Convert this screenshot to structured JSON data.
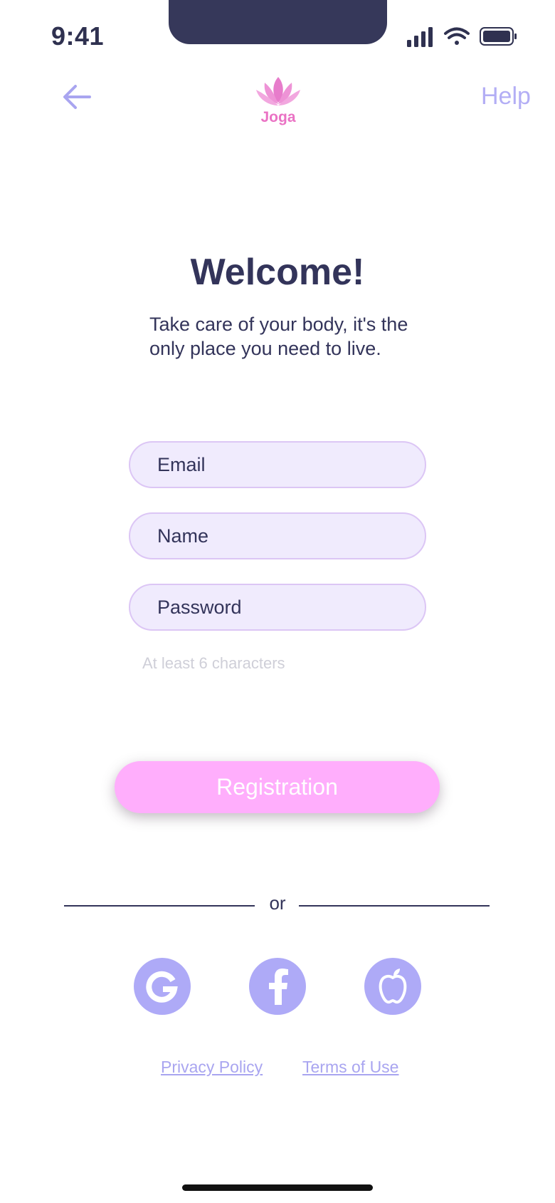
{
  "status_bar": {
    "time": "9:41"
  },
  "header": {
    "help_label": "Help",
    "logo_text": "Joga"
  },
  "welcome": {
    "title": "Welcome!",
    "subtitle": "Take care of your body, it's the only place you need to live."
  },
  "form": {
    "email_placeholder": "Email",
    "name_placeholder": "Name",
    "password_placeholder": "Password",
    "password_hint": "At least 6 characters",
    "submit_label": "Registration"
  },
  "divider": {
    "label": "or"
  },
  "social": [
    {
      "icon": "google-icon"
    },
    {
      "icon": "facebook-icon"
    },
    {
      "icon": "apple-icon"
    }
  ],
  "footer": {
    "privacy_label": "Privacy Policy",
    "terms_label": "Terms of Use"
  },
  "colors": {
    "accent": "#ffaefc",
    "field_bg": "#f0ebfd",
    "field_border": "#dcc6f5",
    "link": "#a9a5f0",
    "social_bg": "#aeaaf7",
    "text": "#33345a"
  }
}
